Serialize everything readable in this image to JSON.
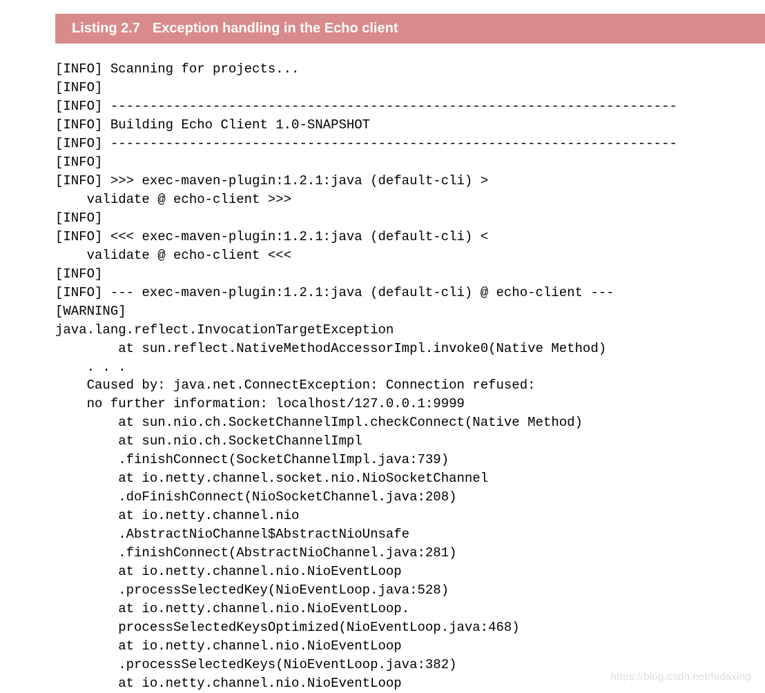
{
  "header": {
    "label": "Listing 2.7",
    "title": "Exception handling in the Echo client"
  },
  "code": {
    "lines": [
      "[INFO] Scanning for projects...",
      "[INFO]",
      "[INFO] ------------------------------------------------------------------------",
      "[INFO] Building Echo Client 1.0-SNAPSHOT",
      "[INFO] ------------------------------------------------------------------------",
      "[INFO]",
      "[INFO] >>> exec-maven-plugin:1.2.1:java (default-cli) >",
      "    validate @ echo-client >>>",
      "[INFO]",
      "[INFO] <<< exec-maven-plugin:1.2.1:java (default-cli) <",
      "    validate @ echo-client <<<",
      "[INFO]",
      "[INFO] --- exec-maven-plugin:1.2.1:java (default-cli) @ echo-client ---",
      "[WARNING]",
      "java.lang.reflect.InvocationTargetException",
      "        at sun.reflect.NativeMethodAccessorImpl.invoke0(Native Method)",
      "    . . .",
      "    Caused by: java.net.ConnectException: Connection refused:",
      "    no further information: localhost/127.0.0.1:9999",
      "        at sun.nio.ch.SocketChannelImpl.checkConnect(Native Method)",
      "        at sun.nio.ch.SocketChannelImpl",
      "        .finishConnect(SocketChannelImpl.java:739)",
      "        at io.netty.channel.socket.nio.NioSocketChannel",
      "        .doFinishConnect(NioSocketChannel.java:208)",
      "        at io.netty.channel.nio",
      "        .AbstractNioChannel$AbstractNioUnsafe",
      "        .finishConnect(AbstractNioChannel.java:281)",
      "        at io.netty.channel.nio.NioEventLoop",
      "        .processSelectedKey(NioEventLoop.java:528)",
      "        at io.netty.channel.nio.NioEventLoop.",
      "        processSelectedKeysOptimized(NioEventLoop.java:468)",
      "        at io.netty.channel.nio.NioEventLoop",
      "        .processSelectedKeys(NioEventLoop.java:382)",
      "        at io.netty.channel.nio.NioEventLoop"
    ]
  },
  "watermark": "https://blog.csdn.net/ludaxing"
}
